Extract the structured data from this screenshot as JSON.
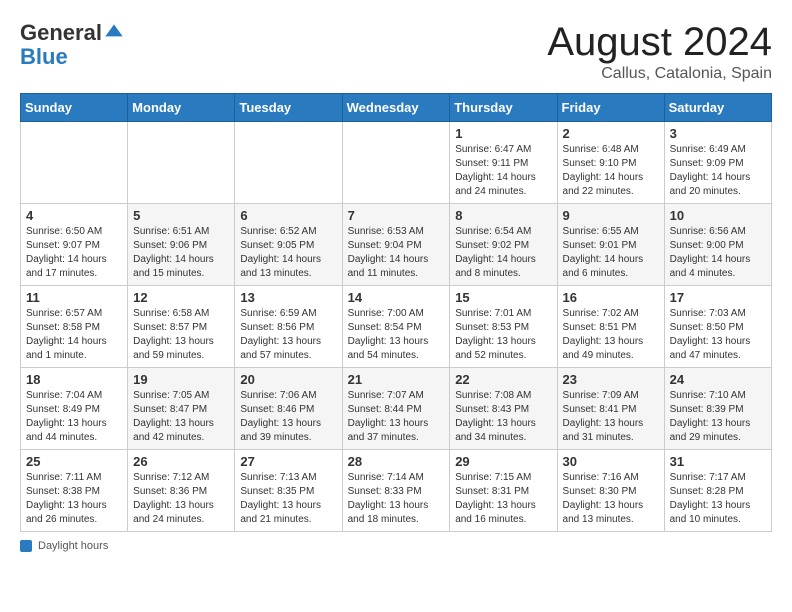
{
  "header": {
    "logo": {
      "general": "General",
      "blue": "Blue"
    },
    "title": "August 2024",
    "location": "Callus, Catalonia, Spain"
  },
  "calendar": {
    "days_of_week": [
      "Sunday",
      "Monday",
      "Tuesday",
      "Wednesday",
      "Thursday",
      "Friday",
      "Saturday"
    ],
    "weeks": [
      [
        {
          "day": "",
          "info": ""
        },
        {
          "day": "",
          "info": ""
        },
        {
          "day": "",
          "info": ""
        },
        {
          "day": "",
          "info": ""
        },
        {
          "day": "1",
          "info": "Sunrise: 6:47 AM\nSunset: 9:11 PM\nDaylight: 14 hours and 24 minutes."
        },
        {
          "day": "2",
          "info": "Sunrise: 6:48 AM\nSunset: 9:10 PM\nDaylight: 14 hours and 22 minutes."
        },
        {
          "day": "3",
          "info": "Sunrise: 6:49 AM\nSunset: 9:09 PM\nDaylight: 14 hours and 20 minutes."
        }
      ],
      [
        {
          "day": "4",
          "info": "Sunrise: 6:50 AM\nSunset: 9:07 PM\nDaylight: 14 hours and 17 minutes."
        },
        {
          "day": "5",
          "info": "Sunrise: 6:51 AM\nSunset: 9:06 PM\nDaylight: 14 hours and 15 minutes."
        },
        {
          "day": "6",
          "info": "Sunrise: 6:52 AM\nSunset: 9:05 PM\nDaylight: 14 hours and 13 minutes."
        },
        {
          "day": "7",
          "info": "Sunrise: 6:53 AM\nSunset: 9:04 PM\nDaylight: 14 hours and 11 minutes."
        },
        {
          "day": "8",
          "info": "Sunrise: 6:54 AM\nSunset: 9:02 PM\nDaylight: 14 hours and 8 minutes."
        },
        {
          "day": "9",
          "info": "Sunrise: 6:55 AM\nSunset: 9:01 PM\nDaylight: 14 hours and 6 minutes."
        },
        {
          "day": "10",
          "info": "Sunrise: 6:56 AM\nSunset: 9:00 PM\nDaylight: 14 hours and 4 minutes."
        }
      ],
      [
        {
          "day": "11",
          "info": "Sunrise: 6:57 AM\nSunset: 8:58 PM\nDaylight: 14 hours and 1 minute."
        },
        {
          "day": "12",
          "info": "Sunrise: 6:58 AM\nSunset: 8:57 PM\nDaylight: 13 hours and 59 minutes."
        },
        {
          "day": "13",
          "info": "Sunrise: 6:59 AM\nSunset: 8:56 PM\nDaylight: 13 hours and 57 minutes."
        },
        {
          "day": "14",
          "info": "Sunrise: 7:00 AM\nSunset: 8:54 PM\nDaylight: 13 hours and 54 minutes."
        },
        {
          "day": "15",
          "info": "Sunrise: 7:01 AM\nSunset: 8:53 PM\nDaylight: 13 hours and 52 minutes."
        },
        {
          "day": "16",
          "info": "Sunrise: 7:02 AM\nSunset: 8:51 PM\nDaylight: 13 hours and 49 minutes."
        },
        {
          "day": "17",
          "info": "Sunrise: 7:03 AM\nSunset: 8:50 PM\nDaylight: 13 hours and 47 minutes."
        }
      ],
      [
        {
          "day": "18",
          "info": "Sunrise: 7:04 AM\nSunset: 8:49 PM\nDaylight: 13 hours and 44 minutes."
        },
        {
          "day": "19",
          "info": "Sunrise: 7:05 AM\nSunset: 8:47 PM\nDaylight: 13 hours and 42 minutes."
        },
        {
          "day": "20",
          "info": "Sunrise: 7:06 AM\nSunset: 8:46 PM\nDaylight: 13 hours and 39 minutes."
        },
        {
          "day": "21",
          "info": "Sunrise: 7:07 AM\nSunset: 8:44 PM\nDaylight: 13 hours and 37 minutes."
        },
        {
          "day": "22",
          "info": "Sunrise: 7:08 AM\nSunset: 8:43 PM\nDaylight: 13 hours and 34 minutes."
        },
        {
          "day": "23",
          "info": "Sunrise: 7:09 AM\nSunset: 8:41 PM\nDaylight: 13 hours and 31 minutes."
        },
        {
          "day": "24",
          "info": "Sunrise: 7:10 AM\nSunset: 8:39 PM\nDaylight: 13 hours and 29 minutes."
        }
      ],
      [
        {
          "day": "25",
          "info": "Sunrise: 7:11 AM\nSunset: 8:38 PM\nDaylight: 13 hours and 26 minutes."
        },
        {
          "day": "26",
          "info": "Sunrise: 7:12 AM\nSunset: 8:36 PM\nDaylight: 13 hours and 24 minutes."
        },
        {
          "day": "27",
          "info": "Sunrise: 7:13 AM\nSunset: 8:35 PM\nDaylight: 13 hours and 21 minutes."
        },
        {
          "day": "28",
          "info": "Sunrise: 7:14 AM\nSunset: 8:33 PM\nDaylight: 13 hours and 18 minutes."
        },
        {
          "day": "29",
          "info": "Sunrise: 7:15 AM\nSunset: 8:31 PM\nDaylight: 13 hours and 16 minutes."
        },
        {
          "day": "30",
          "info": "Sunrise: 7:16 AM\nSunset: 8:30 PM\nDaylight: 13 hours and 13 minutes."
        },
        {
          "day": "31",
          "info": "Sunrise: 7:17 AM\nSunset: 8:28 PM\nDaylight: 13 hours and 10 minutes."
        }
      ]
    ]
  },
  "footer": {
    "label": "Daylight hours"
  }
}
